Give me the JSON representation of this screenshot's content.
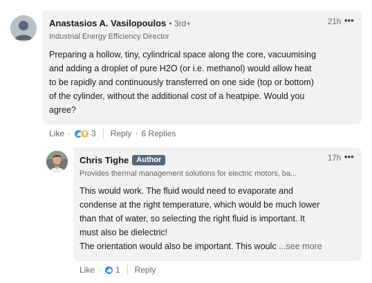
{
  "comments": [
    {
      "author": "Anastasios A. Vasilopoulos",
      "degree": "• 3rd+",
      "headline": "Industrial Energy Efficiency Director",
      "time": "21h",
      "more": "•••",
      "lines": [
        "Preparing a hollow, tiny, cylindrical space along the core, vacuumising",
        "and adding a droplet of pure H2O (or i.e. methanol) would allow heat",
        "to be rapidly and continuously transferred on one side (top or bottom)",
        "of the cylinder, without the additional cost of a heatpipe. Would you",
        "agree?"
      ],
      "actions": {
        "like": "Like",
        "dot": "·",
        "reaction_count": "3",
        "reply": "Reply",
        "replies": "6 Replies"
      }
    },
    {
      "author": "Chris Tighe",
      "badge": "Author",
      "headline": "Provides thermal management solutions for electric motors, ba...",
      "time": "17h",
      "more": "•••",
      "lines": [
        "This would work. The fluid would need to evaporate and",
        "condense at the right temperature, which would be much lower",
        "than that of water, so selecting the right fluid is important. It",
        "must also be dielectric!",
        "The orientation would also be important. This woulc"
      ],
      "see_more": "...see more",
      "actions": {
        "like": "Like",
        "dot": "·",
        "reaction_count": "1",
        "reply": "Reply"
      }
    }
  ],
  "reactions": {
    "like_color": "#378fe9",
    "insight_color": "#f5bb5c"
  },
  "icons": [
    "like-reaction-icon",
    "insightful-reaction-icon",
    "more-options-icon"
  ]
}
